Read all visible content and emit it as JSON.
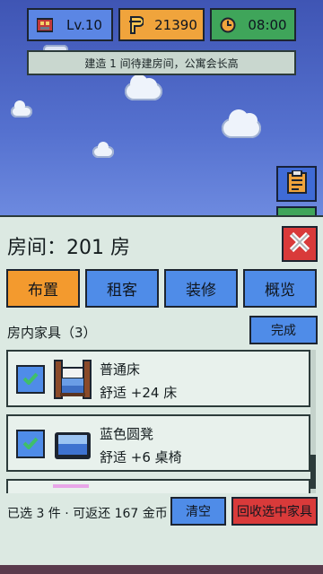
{
  "hud": {
    "level": "Lv.10",
    "coins": "21390",
    "time": "08:00",
    "level_icon": "building-map-icon",
    "coins_icon": "coin-p-icon",
    "time_icon": "clock-icon"
  },
  "tip": "建造 1 间待建房间，公寓会长高",
  "side_buttons": {
    "clipboard_icon": "clipboard-icon"
  },
  "panel": {
    "title": "房间：201 房",
    "close_icon": "close-icon",
    "tabs": [
      {
        "label": "布置",
        "active": true
      },
      {
        "label": "租客",
        "active": false
      },
      {
        "label": "装修",
        "active": false
      },
      {
        "label": "概览",
        "active": false
      }
    ],
    "section_label": "房内家具（3）",
    "done_label": "完成",
    "furniture": [
      {
        "name": "普通床",
        "desc": "舒适 +24  床",
        "checked": true,
        "icon": "bed-icon"
      },
      {
        "name": "蓝色圆凳",
        "desc": "舒适 +6  桌椅",
        "checked": true,
        "icon": "stool-icon"
      }
    ],
    "summary": "已选 3 件 · 可返还 167 金币",
    "clear_label": "清空",
    "recycle_label": "回收选中家具"
  },
  "colors": {
    "primary_blue": "#4f8ce8",
    "active_orange": "#f39a2e",
    "danger_red": "#d93a3a",
    "panel_bg": "#dce9e2",
    "sky": "#4a64c2"
  }
}
